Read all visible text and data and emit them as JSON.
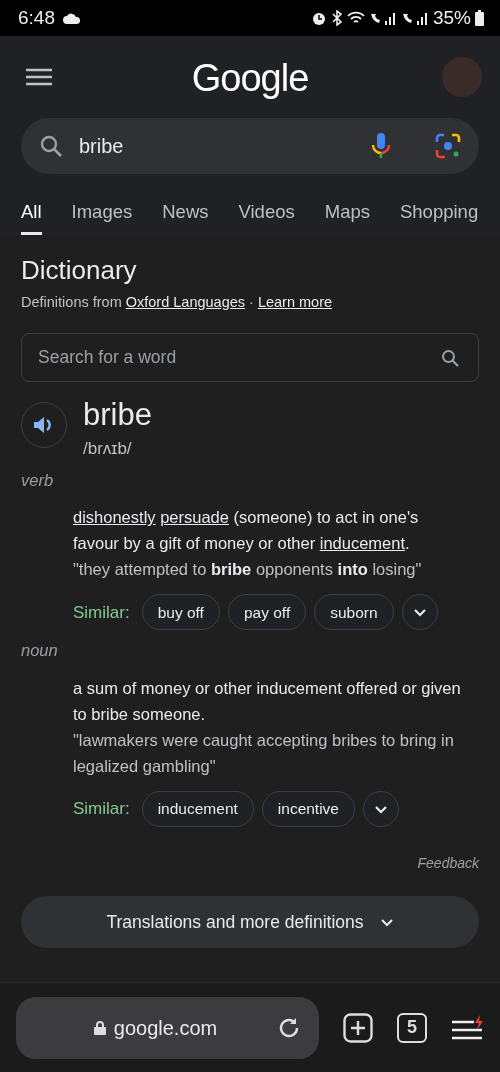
{
  "status_bar": {
    "time": "6:48",
    "battery": "35%"
  },
  "header": {
    "logo": "Google"
  },
  "search": {
    "value": "bribe"
  },
  "tabs": [
    {
      "label": "All",
      "selected": true
    },
    {
      "label": "Images",
      "selected": false
    },
    {
      "label": "News",
      "selected": false
    },
    {
      "label": "Videos",
      "selected": false
    },
    {
      "label": "Maps",
      "selected": false
    },
    {
      "label": "Shopping",
      "selected": false
    }
  ],
  "dictionary": {
    "title": "Dictionary",
    "source_prefix": "Definitions from",
    "source_link": "Oxford Languages",
    "separator": "·",
    "learn_more": "Learn more",
    "search_placeholder": "Search for a word",
    "word": "bribe",
    "phonetic": "/brʌɪb/",
    "senses": [
      {
        "part_of_speech": "verb",
        "definition": [
          {
            "text": "dishonestly",
            "link": true
          },
          {
            "text": "persuade",
            "link": true
          },
          {
            "text": " (someone) to act in one's favour by a gift of money or other ",
            "link": false
          },
          {
            "text": "inducement",
            "link": true
          },
          {
            "text": ".",
            "link": false
          }
        ],
        "example": "\"they attempted to **bribe** opponents **into** losing\"",
        "similar_label": "Similar:",
        "similar": [
          "buy off",
          "pay off",
          "suborn"
        ]
      },
      {
        "part_of_speech": "noun",
        "definition": [
          {
            "text": "a sum of money or other inducement offered or given to bribe someone.",
            "link": false
          }
        ],
        "example": "\"lawmakers were caught accepting bribes to bring in legalized gambling\"",
        "similar_label": "Similar:",
        "similar": [
          "inducement",
          "incentive"
        ]
      }
    ],
    "feedback": "Feedback",
    "more_button": "Translations and more definitions"
  },
  "bottom_bar": {
    "url": "google.com",
    "tab_count": "5"
  }
}
